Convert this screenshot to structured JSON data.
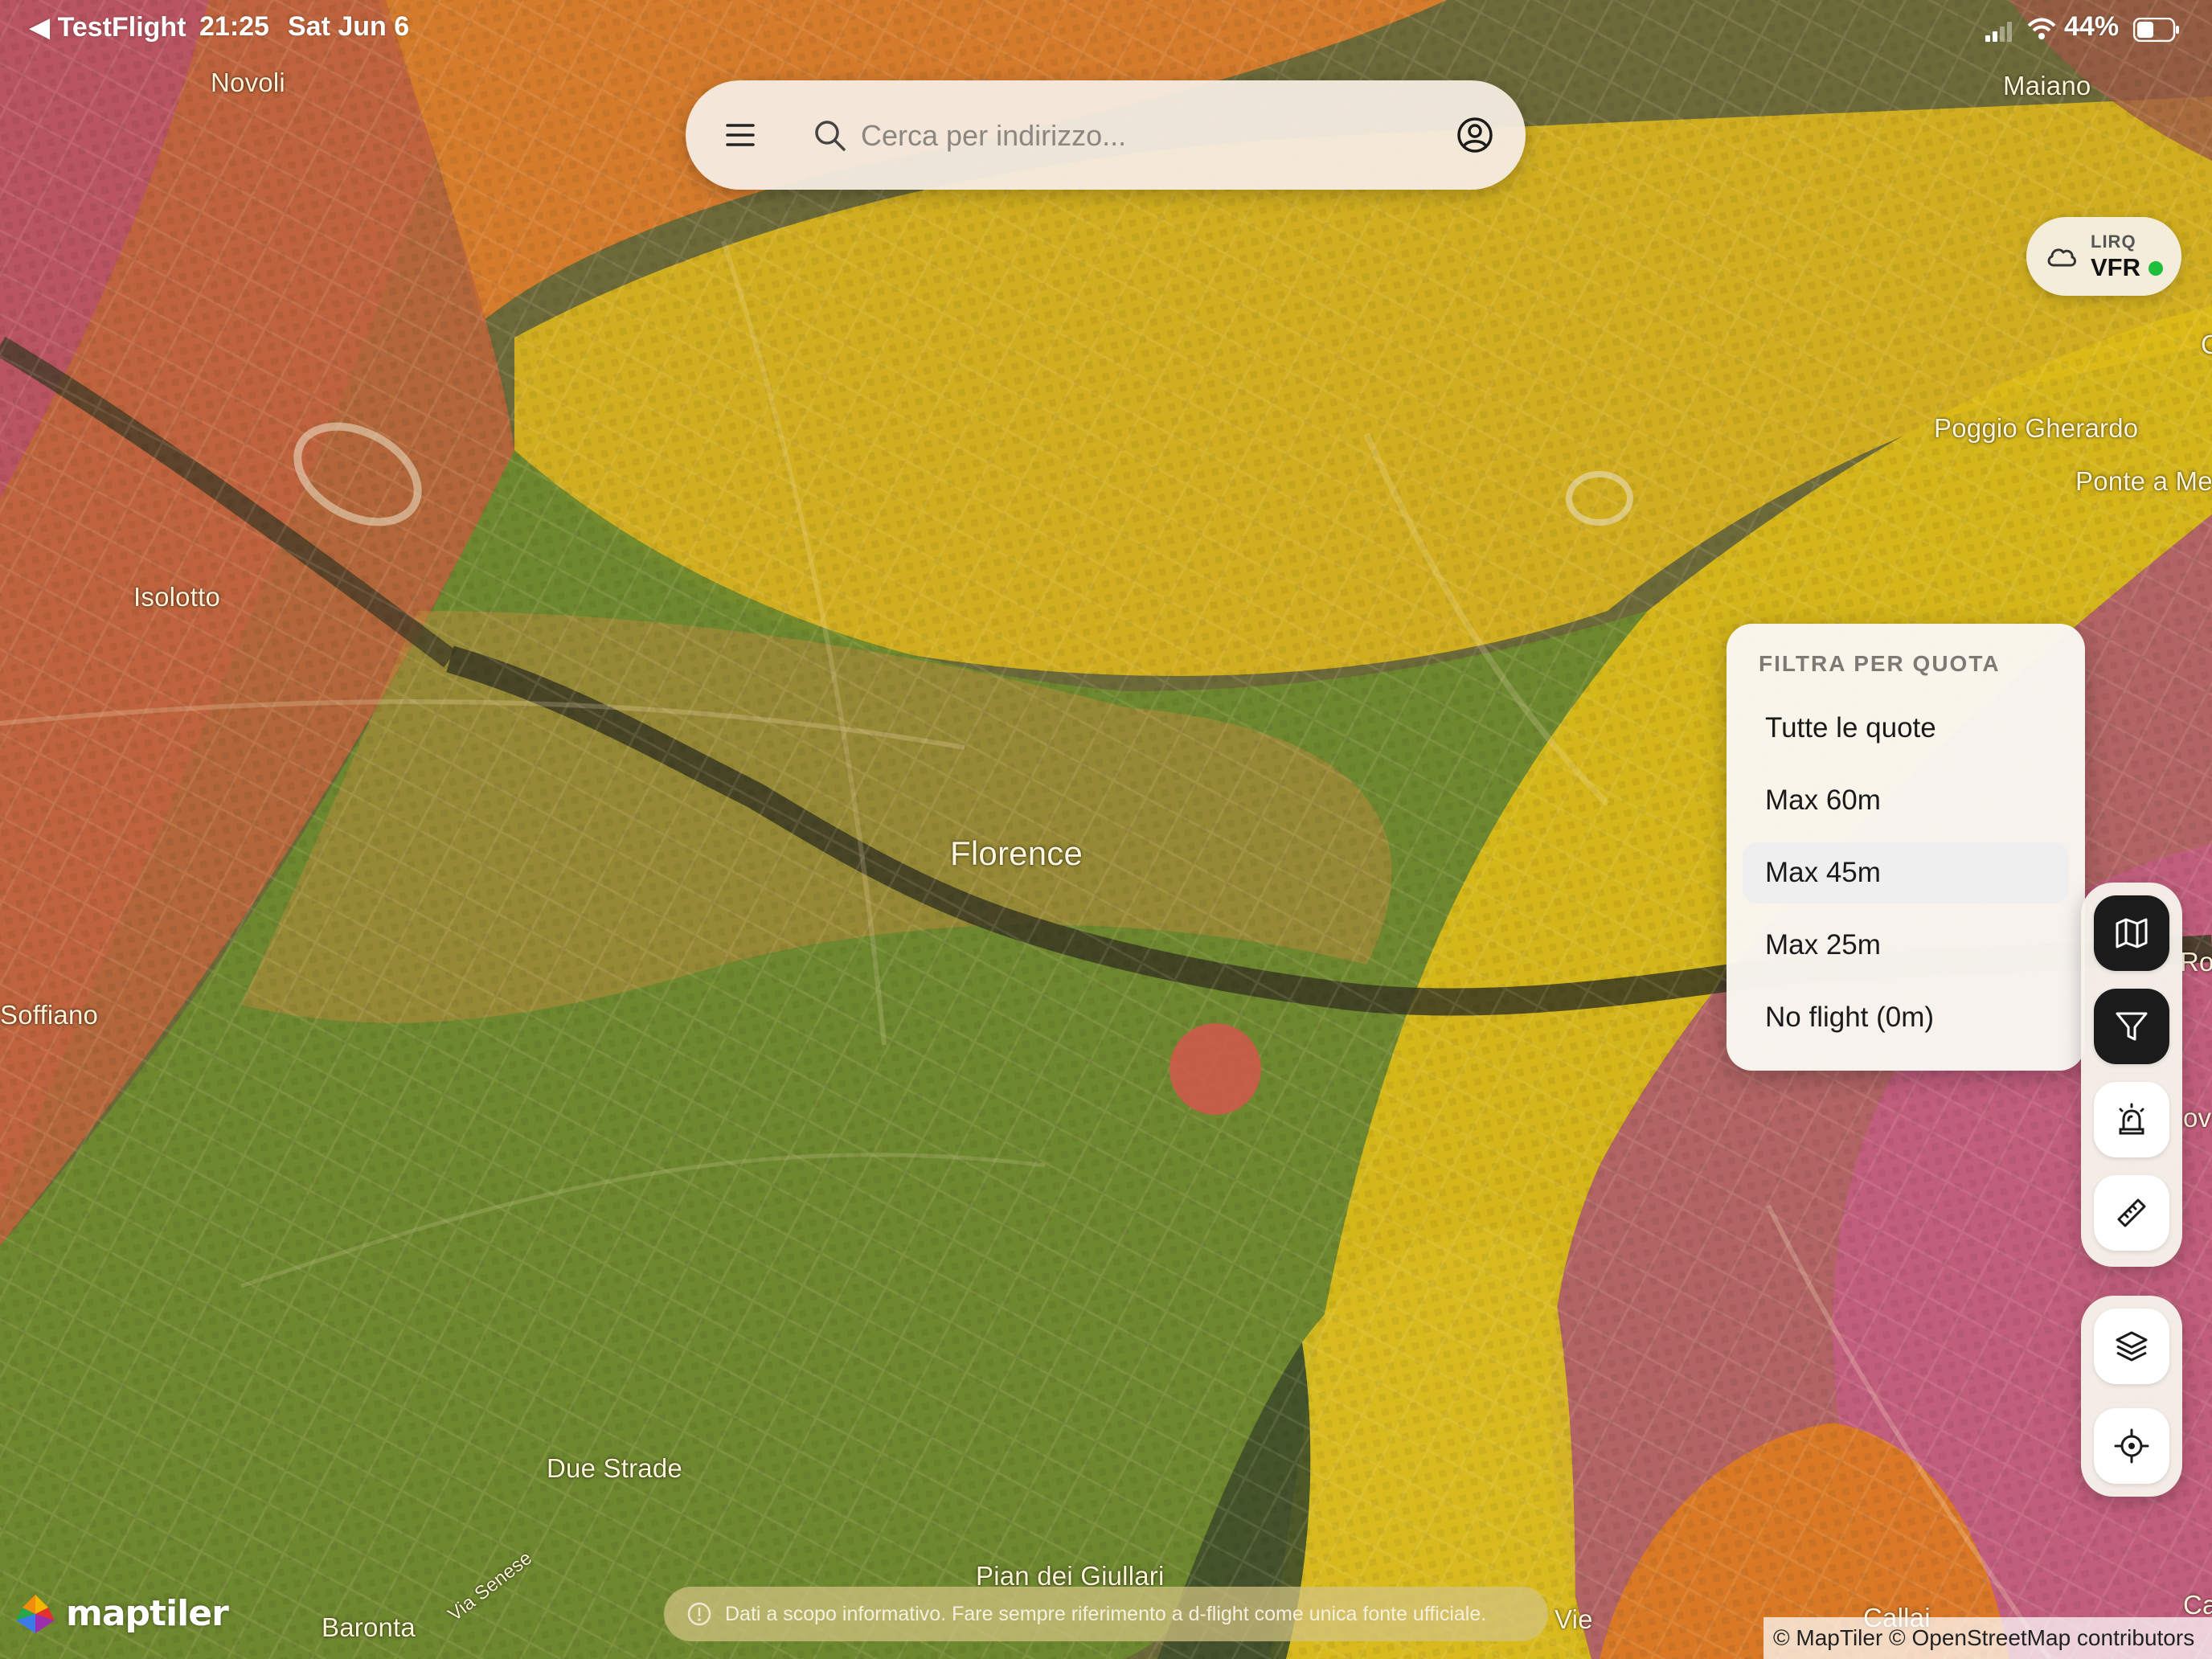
{
  "status_bar": {
    "back_app": "TestFlight",
    "time": "21:25",
    "date": "Sat Jun 6",
    "battery": "44%"
  },
  "search": {
    "placeholder": "Cerca per indirizzo..."
  },
  "weather": {
    "station": "LIRQ",
    "category": "VFR",
    "status_color": "#1fbf3b"
  },
  "filter_menu": {
    "title": "FILTRA PER QUOTA",
    "options": [
      {
        "label": "Tutte le quote"
      },
      {
        "label": "Max 60m"
      },
      {
        "label": "Max 45m"
      },
      {
        "label": "Max 25m"
      },
      {
        "label": "No flight (0m)"
      }
    ],
    "selected": "Max 45m"
  },
  "map": {
    "places": {
      "novoli": "Novoli",
      "maiano": "Maiano",
      "isolotto": "Isolotto",
      "poggio_gherardo": "Poggio Gherardo",
      "ponte_a_mensola": "Ponte a Me",
      "florence": "Florence",
      "soffiano": "Soffiano",
      "rovezzano": "Rov",
      "rovezzano2": "ov",
      "due_strade": "Due Strade",
      "pian_dei_giullari": "Pian dei Giullari",
      "baronta": "Baronta",
      "via_senese": "Via Senese",
      "vie": "Vie",
      "callai": "Callai",
      "ca": "Ca",
      "edge_c": "C"
    },
    "zone_colors": {
      "red": "#c2524e",
      "orange": "#e57a1e",
      "yellow": "#e3c21a",
      "green": "#6f8e2e",
      "pink": "#c9607a"
    }
  },
  "tools": {
    "map_icon": "map-icon",
    "filter_icon": "filter-icon",
    "alert_icon": "siren-icon",
    "ruler_icon": "ruler-icon",
    "layers_icon": "layers-icon",
    "locate_icon": "locate-icon"
  },
  "disclaimer": "Dati a scopo informativo. Fare sempre riferimento a d-flight come unica fonte ufficiale.",
  "branding": {
    "logo": "maptiler"
  },
  "attribution": "© MapTiler © OpenStreetMap contributors"
}
